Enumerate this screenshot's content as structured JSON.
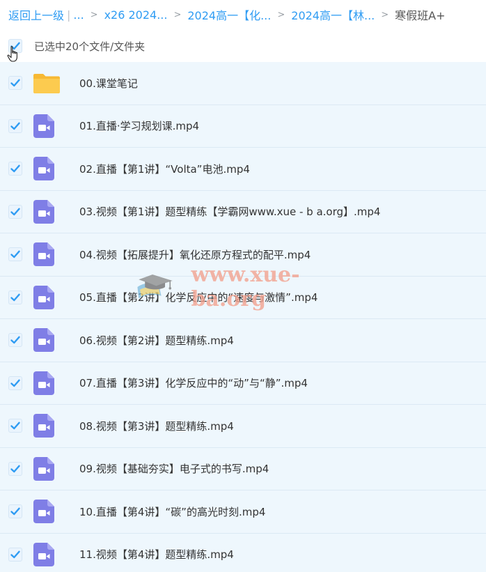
{
  "breadcrumb": {
    "back_label": "返回上一级",
    "ellipsis": "...",
    "crumbs": [
      "x26 2024...",
      "2024高一【化...",
      "2024高一【林..."
    ],
    "current": "寒假班A+"
  },
  "selection": {
    "summary": "已选中20个文件/文件夹"
  },
  "files": [
    {
      "name": "00.课堂笔记",
      "type": "folder"
    },
    {
      "name": "01.直播·学习规划课.mp4",
      "type": "video"
    },
    {
      "name": "02.直播【第1讲】“Volta”电池.mp4",
      "type": "video"
    },
    {
      "name": "03.视频【第1讲】题型精练【学霸网www.xue - b a.org】.mp4",
      "type": "video"
    },
    {
      "name": "04.视频【拓展提升】氧化还原方程式的配平.mp4",
      "type": "video"
    },
    {
      "name": "05.直播【第2讲】化学反应中的“速度与激情”.mp4",
      "type": "video"
    },
    {
      "name": "06.视频【第2讲】题型精练.mp4",
      "type": "video"
    },
    {
      "name": "07.直播【第3讲】化学反应中的“动”与“静”.mp4",
      "type": "video"
    },
    {
      "name": "08.视频【第3讲】题型精练.mp4",
      "type": "video"
    },
    {
      "name": "09.视频【基础夯实】电子式的书写.mp4",
      "type": "video"
    },
    {
      "name": "10.直播【第4讲】“碳”的高光时刻.mp4",
      "type": "video"
    },
    {
      "name": "11.视频【第4讲】题型精练.mp4",
      "type": "video"
    }
  ],
  "watermark": {
    "text": "www.xue-ba.org"
  },
  "colors": {
    "link": "#2f9cf3",
    "row_bg": "#eef7fd",
    "check": "#2f9cf3",
    "video_icon": "#7f7ee6",
    "folder_icon": "#fcc94a",
    "watermark": "#f3a08d"
  }
}
